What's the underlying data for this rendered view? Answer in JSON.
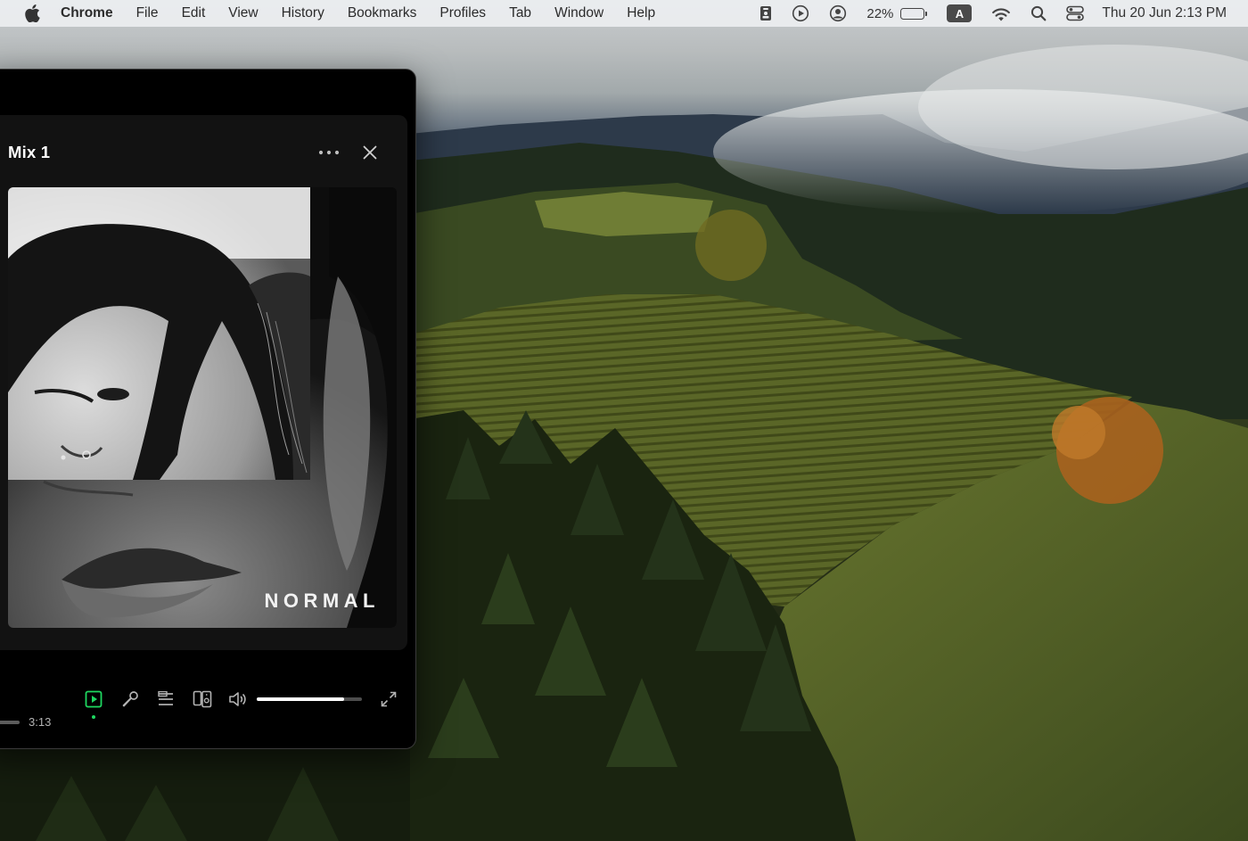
{
  "menubar": {
    "app_name": "Chrome",
    "items": [
      "File",
      "Edit",
      "View",
      "History",
      "Bookmarks",
      "Profiles",
      "Tab",
      "Window",
      "Help"
    ],
    "battery_percent": "22%",
    "battery_level": 0.22,
    "input_source": "A",
    "clock": "Thu 20 Jun  2:13 PM",
    "status_icons": [
      "badge-icon",
      "play-circle-icon",
      "user-circle-icon",
      "battery-icon",
      "input-source-icon",
      "wifi-icon",
      "spotlight-search-icon",
      "control-center-icon"
    ]
  },
  "player": {
    "title": "Mix 1",
    "cover_text": "NORMAL",
    "total_time": "3:13",
    "volume_level": 0.83,
    "accent_color": "#1ed760",
    "controls": [
      "now-playing-view-icon",
      "mic-lyrics-icon",
      "queue-icon",
      "connect-device-icon",
      "volume-icon",
      "fullscreen-icon"
    ]
  }
}
